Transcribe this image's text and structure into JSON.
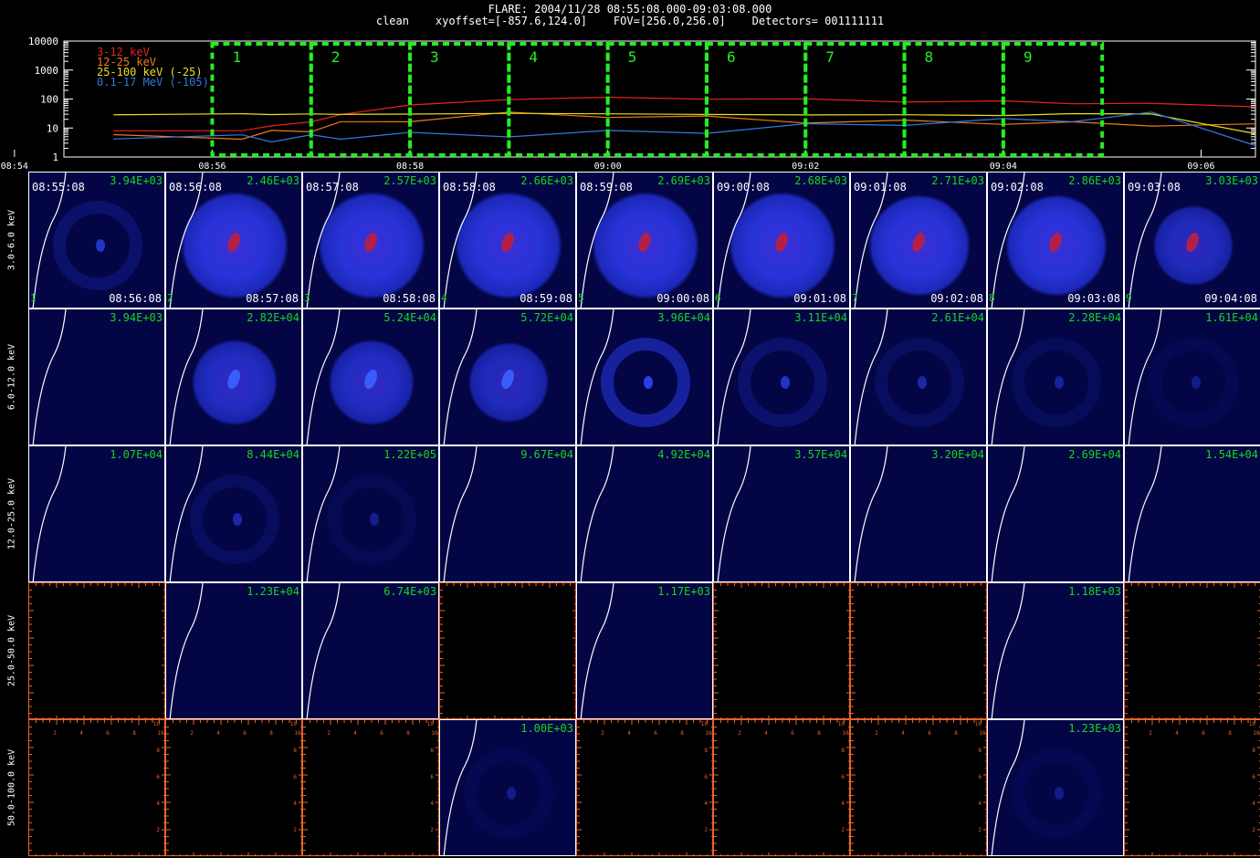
{
  "header": {
    "title_line1": "FLARE: 2004/11/28 08:55:08.000-09:03:08.000",
    "title_line2": "clean    xyoffset=[-857.6,124.0]    FOV=[256.0,256.0]    Detectors= 001111111"
  },
  "chart_data": [
    {
      "type": "line",
      "title": "",
      "yscale": "log",
      "ylim": [
        1,
        10000
      ],
      "y_ticks": [
        "1",
        "10",
        "100",
        "1000",
        "10000"
      ],
      "x_ticks": [
        "08:54",
        "08:56",
        "08:58",
        "09:00",
        "09:02",
        "09:04",
        "09:06"
      ],
      "xlim_minutes": [
        -0.5,
        11.55
      ],
      "legend_position": "top-left",
      "x": [
        0,
        1.3,
        1.6,
        2,
        2.3,
        3,
        4,
        5,
        6,
        7,
        8,
        9,
        9.7,
        10.5,
        11.55
      ],
      "series": [
        {
          "name": "3-12 keV",
          "color": "#e8231e",
          "values": [
            8,
            8,
            12,
            16,
            30,
            60,
            100,
            110,
            105,
            95,
            85,
            80,
            75,
            65,
            60
          ]
        },
        {
          "name": "12-25 keV",
          "color": "#f07a18",
          "values": [
            5,
            5,
            7,
            9,
            14,
            20,
            30,
            28,
            22,
            18,
            16,
            16,
            14,
            14,
            12
          ]
        },
        {
          "name": "25-100 keV (-25)",
          "color": "#e8e01c",
          "values": [
            30,
            30,
            30,
            30,
            30,
            30,
            32,
            31,
            29,
            29,
            28,
            28,
            30,
            32,
            6
          ]
        },
        {
          "name": "0.1-17 MeV (-105)",
          "color": "#2f78e8",
          "values": [
            5,
            5,
            4,
            5,
            5,
            6,
            6,
            7,
            8,
            12,
            15,
            18,
            20,
            30,
            3
          ]
        }
      ],
      "interval_boxes": [
        "1",
        "2",
        "3",
        "4",
        "5",
        "6",
        "7",
        "8",
        "9"
      ],
      "interval_box_color": "#22ee22"
    },
    {
      "type": "heatmap",
      "description": "image grid: rows = energy bands, columns = time intervals 1-9",
      "rows": [
        {
          "energy": "3.0-6.0 keV",
          "max": [
            "3.94E+03",
            "2.46E+03",
            "2.57E+03",
            "2.66E+03",
            "2.69E+03",
            "2.68E+03",
            "2.71E+03",
            "2.86E+03",
            "3.03E+03"
          ],
          "intensity": [
            0.15,
            1.0,
            1.0,
            1.0,
            1.0,
            0.95,
            0.9,
            0.9,
            0.7
          ],
          "has_image": [
            true,
            true,
            true,
            true,
            true,
            true,
            true,
            true,
            true
          ]
        },
        {
          "energy": "6.0-12.0 keV",
          "max": [
            "3.94E+03",
            "2.82E+04",
            "5.24E+04",
            "5.72E+04",
            "3.96E+04",
            "3.11E+04",
            "2.61E+04",
            "2.28E+04",
            "1.61E+04"
          ],
          "intensity": [
            0.0,
            0.75,
            0.75,
            0.7,
            0.35,
            0.15,
            0.1,
            0.08,
            0.05
          ],
          "has_image": [
            true,
            true,
            true,
            true,
            true,
            true,
            true,
            true,
            true
          ]
        },
        {
          "energy": "12.0-25.0 keV",
          "max": [
            "1.07E+04",
            "8.44E+04",
            "1.22E+05",
            "9.67E+04",
            "4.92E+04",
            "3.57E+04",
            "3.20E+04",
            "2.69E+04",
            "1.54E+04"
          ],
          "intensity": [
            0,
            0.1,
            0.06,
            0,
            0,
            0,
            0,
            0,
            0
          ],
          "has_image": [
            true,
            true,
            true,
            true,
            true,
            true,
            true,
            true,
            true
          ]
        },
        {
          "energy": "25.0-50.0 keV",
          "max": [
            "",
            "1.23E+04",
            "6.74E+03",
            "",
            "1.17E+03",
            "",
            "",
            "1.18E+03",
            ""
          ],
          "intensity": [
            0,
            0,
            0,
            0,
            0,
            0,
            0,
            0,
            0
          ],
          "has_image": [
            false,
            true,
            true,
            false,
            true,
            false,
            false,
            true,
            false
          ]
        },
        {
          "energy": "50.0-100.0 keV",
          "max": [
            "",
            "",
            "",
            "1.00E+03",
            "",
            "",
            "",
            "1.23E+03",
            ""
          ],
          "intensity": [
            0,
            0,
            0,
            0.05,
            0,
            0,
            0,
            0.05,
            0
          ],
          "has_image": [
            false,
            false,
            false,
            true,
            false,
            false,
            false,
            true,
            false
          ]
        }
      ],
      "start_times": [
        "08:55:08",
        "08:56:08",
        "08:57:08",
        "08:58:08",
        "08:59:08",
        "09:00:08",
        "09:01:08",
        "09:02:08",
        "09:03:08"
      ],
      "end_times": [
        "08:56:08",
        "08:57:08",
        "08:58:08",
        "08:59:08",
        "09:00:08",
        "09:01:08",
        "09:02:08",
        "09:03:08",
        "09:04:08"
      ],
      "empty_panel_axis_ticks": [
        "2",
        "4",
        "6",
        "8",
        "10"
      ]
    }
  ]
}
